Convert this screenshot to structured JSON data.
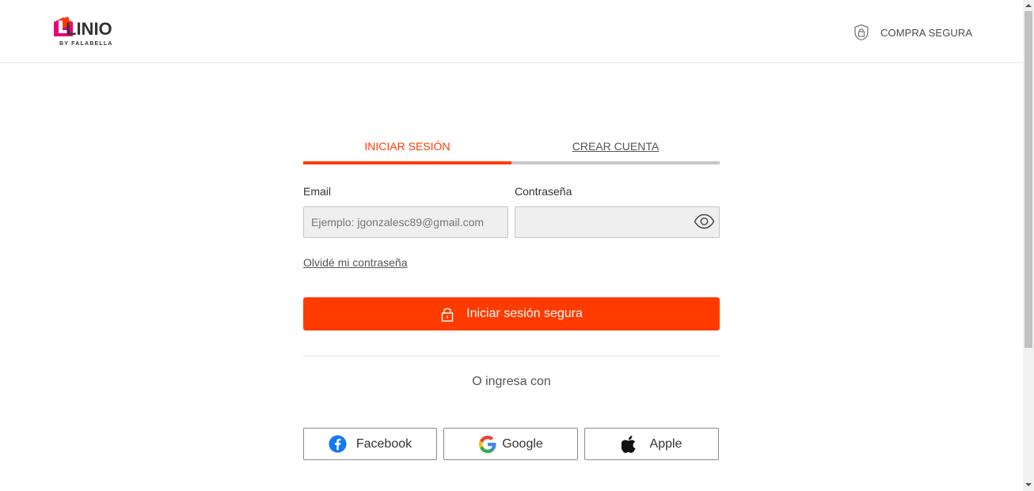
{
  "header": {
    "logo_text": "LINIO",
    "logo_subtext": "BY FALABELLA",
    "secure_label": "COMPRA SEGURA",
    "secure_icon": "shield-lock-icon"
  },
  "tabs": [
    {
      "label": "INICIAR SESIÓN",
      "active": true
    },
    {
      "label": "CREAR CUENTA",
      "active": false
    }
  ],
  "form": {
    "email_label": "Email",
    "email_value": "",
    "email_placeholder": "Ejemplo: jgonzalesc89@gmail.com",
    "password_label": "Contraseña",
    "password_value": "",
    "password_toggle_icon": "eye-icon",
    "forgot_link": "Olvidé mi contraseña",
    "submit_label": "Iniciar sesión segura",
    "submit_icon": "lock-icon"
  },
  "social": {
    "divider_text": "O ingresa con",
    "buttons": [
      {
        "label": "Facebook",
        "icon": "facebook-icon"
      },
      {
        "label": "Google",
        "icon": "google-icon"
      },
      {
        "label": "Apple",
        "icon": "apple-icon"
      }
    ]
  },
  "colors": {
    "brand": "#ff3b00",
    "tab_inactive_bar": "#c8c8c8",
    "facebook": "#1877f2"
  }
}
